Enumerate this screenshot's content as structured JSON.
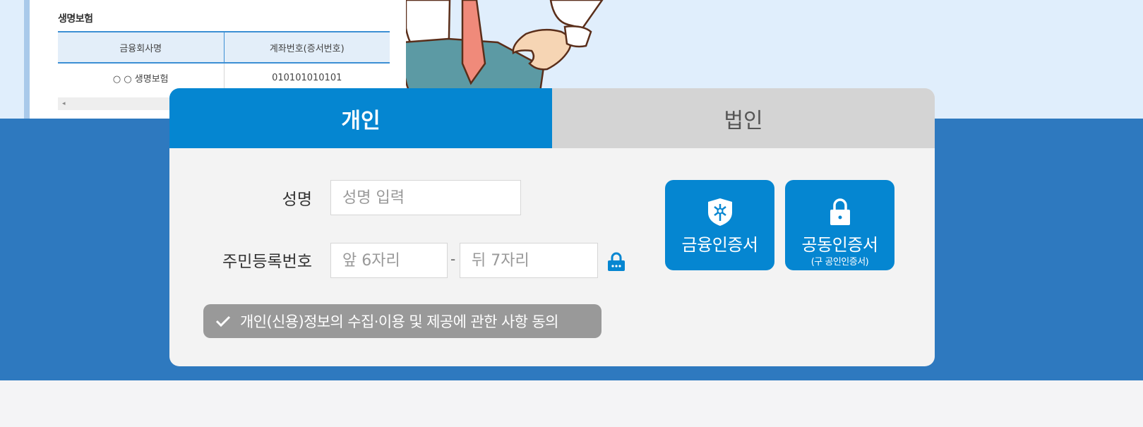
{
  "document": {
    "title": "생명보험",
    "columns": [
      "금융회사명",
      "계좌번호(증서번호)"
    ],
    "rows": [
      [
        "○ ○ 생명보험",
        "010101010101"
      ]
    ],
    "scroll_arrow": "◂"
  },
  "tabs": [
    {
      "label": "개인",
      "active": true
    },
    {
      "label": "법인",
      "active": false
    }
  ],
  "form": {
    "name_label": "성명",
    "name_placeholder": "성명 입력",
    "rrn_label": "주민등록번호",
    "rrn_front_placeholder": "앞 6자리",
    "rrn_separator": "-",
    "rrn_back_placeholder": "뒤 7자리",
    "keyboard_icon": "secure-keyboard-lock-icon"
  },
  "consent": {
    "label": "개인(신용)정보의 수집·이용 및 제공에 관한 사항 동의",
    "icon": "check-icon"
  },
  "certificates": {
    "financial": {
      "label": "금융인증서",
      "icon": "shield-key-icon"
    },
    "joint": {
      "label": "공동인증서",
      "sublabel": "(구 공인인증서)",
      "icon": "lock-icon"
    }
  },
  "colors": {
    "primary": "#0586d1",
    "band": "#2e79bf",
    "top_bg": "#e0eefc",
    "tab_inactive": "#d4d4d4",
    "consent_bg": "#999999"
  }
}
